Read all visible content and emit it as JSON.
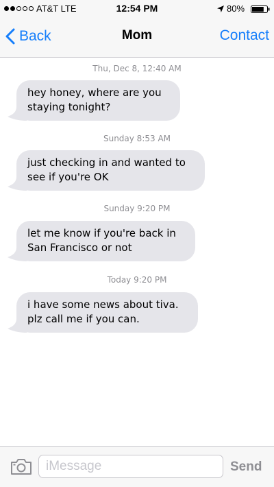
{
  "status_bar": {
    "carrier": "AT&T LTE",
    "time": "12:54 PM",
    "battery": "80%",
    "battery_level": 0.8,
    "signal_bars": 2,
    "signal_total": 5,
    "icons": [
      "location-arrow-icon",
      "battery-icon"
    ]
  },
  "nav": {
    "back_label": "Back",
    "title": "Mom",
    "contact_label": "Contact"
  },
  "messages": [
    {
      "timestamp": "Thu, Dec 8, 12:40 AM",
      "text": "hey honey, where are you\nstaying tonight?"
    },
    {
      "timestamp": "Sunday 8:53 AM",
      "text": "just checking in and wanted to\nsee if you're OK"
    },
    {
      "timestamp": "Sunday 9:20 PM",
      "text": "let me know if you're back in\nSan Francisco or not"
    },
    {
      "timestamp": "Today 9:20 PM",
      "text": "i have some news about tiva.\nplz call me if you can."
    }
  ],
  "input_bar": {
    "placeholder": "iMessage",
    "value": "",
    "send_label": "Send",
    "camera_icon": "camera-icon"
  },
  "colors": {
    "accent": "#157efb",
    "bubble_incoming": "#e5e5ea",
    "timestamp_text": "#8e8e93",
    "bar_background": "#f7f7f7"
  }
}
